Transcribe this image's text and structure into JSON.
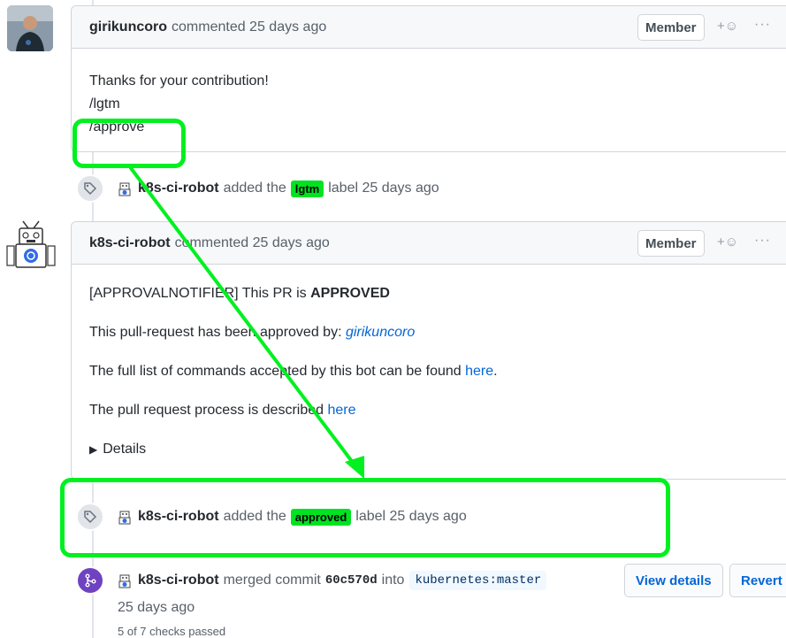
{
  "comment1": {
    "author": "girikuncoro",
    "meta": "commented 25 days ago",
    "badge": "Member",
    "lines": [
      "Thanks for your contribution!",
      "/lgtm",
      "/approve"
    ]
  },
  "event1": {
    "actor": "k8s-ci-robot",
    "pre": "added the",
    "label": "lgtm",
    "post": "label 25 days ago"
  },
  "comment2": {
    "author": "k8s-ci-robot",
    "meta": "commented 25 days ago",
    "badge": "Member",
    "notifier_pre": "[APPROVALNOTIFIER] This PR is ",
    "notifier_status": "APPROVED",
    "approved_by_pre": "This pull-request has been approved by: ",
    "approved_by_user": "girikuncoro",
    "commands_pre": "The full list of commands accepted by this bot can be found ",
    "commands_link": "here",
    "commands_post": ".",
    "process_pre": "The pull request process is described ",
    "process_link": "here",
    "details": "Details"
  },
  "event2": {
    "actor": "k8s-ci-robot",
    "pre": "added the",
    "label": "approved",
    "post": "label 25 days ago"
  },
  "merge": {
    "actor": "k8s-ci-robot",
    "pre": "merged commit",
    "commit": "60c570d",
    "into": "into",
    "branch": "kubernetes:master",
    "time": "25 days ago",
    "checks": "5 of 7 checks passed",
    "view_details": "View details",
    "revert": "Revert"
  },
  "colors": {
    "highlight": "#00f020",
    "label_green": "#00e321",
    "link": "#0366d6",
    "merge_purple": "#6f42c1"
  }
}
